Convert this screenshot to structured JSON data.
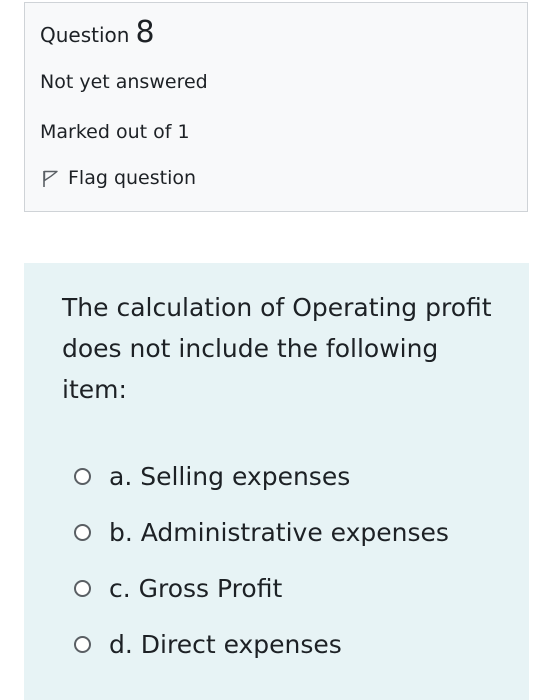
{
  "question_info": {
    "label": "Question",
    "number": "8",
    "state": "Not yet answered",
    "grade": "Marked out of 1",
    "flag_label": "Flag question"
  },
  "question": {
    "text": "The calculation of Operating profit does not include the following item:",
    "options": [
      {
        "label": "a. Selling expenses"
      },
      {
        "label": "b. Administrative expenses"
      },
      {
        "label": "c. Gross Profit"
      },
      {
        "label": "d. Direct expenses"
      }
    ]
  },
  "colors": {
    "info_background": "#f8f9fa",
    "info_border": "#cfd3d7",
    "formulation_background": "#e7f3f5",
    "text": "#1d2125"
  },
  "icons": {
    "flag": "flag-icon",
    "radio": "radio-button"
  }
}
